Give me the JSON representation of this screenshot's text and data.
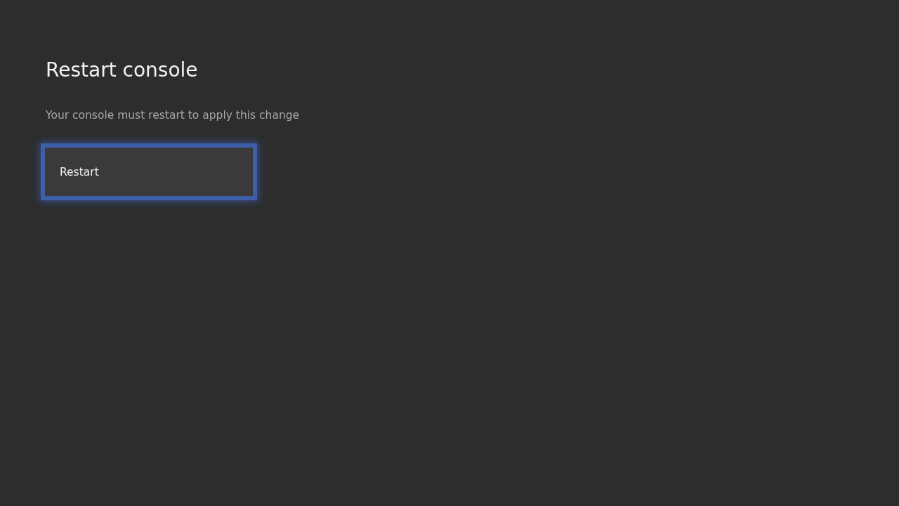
{
  "page": {
    "title": "Restart console",
    "description": "Your console must restart to apply this change"
  },
  "buttons": [
    {
      "label": "Restart",
      "focused": true
    }
  ]
}
